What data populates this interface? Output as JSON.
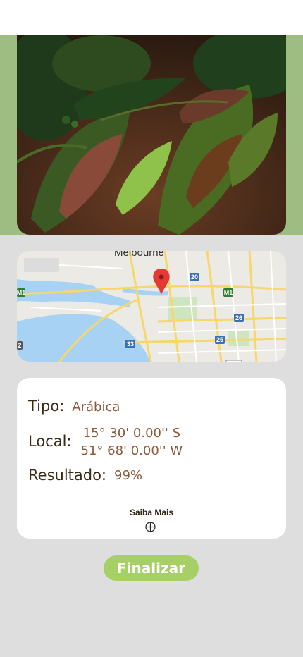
{
  "photo": {
    "icon": "coffee-leaf-rust-photo"
  },
  "map": {
    "city_label": "Melbourne",
    "markers": [
      "20",
      "M1",
      "M1",
      "26",
      "33",
      "25",
      "2"
    ],
    "pin_color": "#e53935"
  },
  "details": {
    "tipo_label": "Tipo:",
    "tipo_value": "Arábica",
    "local_label": "Local:",
    "lat": "15° 30' 0.00'' S",
    "lng": "51° 68' 0.00'' W",
    "resultado_label": "Resultado:",
    "resultado_value": "99%",
    "saiba_mais": "Saiba Mais",
    "saiba_icon": "crosshair-icon"
  },
  "finalizar_label": "Finalizar",
  "colors": {
    "background": "#dedede",
    "accent": "#a6d066",
    "label": "#3b2a14",
    "value": "#8a5a3c",
    "photo_band": "#9dbd82"
  }
}
